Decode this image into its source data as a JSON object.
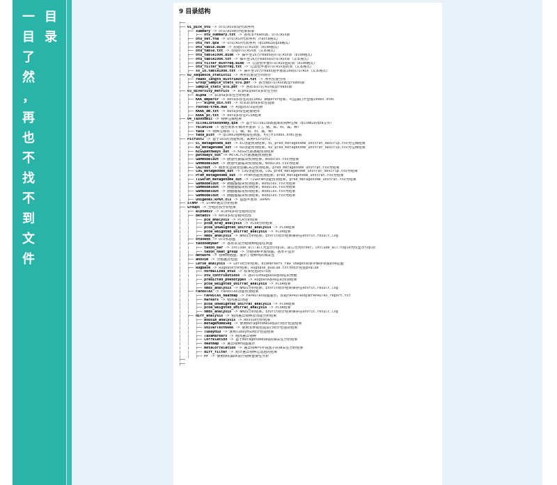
{
  "banner": {
    "left_column": [
      "一",
      "目",
      "了",
      "然",
      "，",
      "再",
      "也",
      "不",
      "找",
      "不",
      "到",
      "文",
      "件"
    ],
    "right_column": [
      "目",
      "录"
    ]
  },
  "document": {
    "heading": "9 目录结构",
    "tree": [
      {
        "d": 0,
        "name": "",
        "desc": ""
      },
      {
        "d": 1,
        "name": "01_pick_otu",
        "desc": "OTU/ASV表及代表序列"
      },
      {
        "d": 2,
        "name": "summary",
        "desc": "OTU/ASV统计结果目录"
      },
      {
        "d": 3,
        "name": "otu_summary.txt",
        "desc": "各样本reads数、OTU/ASV数"
      },
      {
        "d": 2,
        "name": "otu_set.fna",
        "desc": "OTU/ASV代表序列（fasta格式）"
      },
      {
        "d": 2,
        "name": "otu_ref.qza",
        "desc": "OTU/ASV代表序列（qiime2的qza格式）"
      },
      {
        "d": 2,
        "name": "otu_table.biom",
        "desc": "原始OTU/ASV表（biom格式）"
      },
      {
        "d": 2,
        "name": "otu_table.txt",
        "desc": "原始OTU/ASV表（文本格式）"
      },
      {
        "d": 2,
        "name": "otu_table100k.biom",
        "desc": "抽平至10万reads的OTU/ASV表（biom格式）"
      },
      {
        "d": 2,
        "name": "otu_table100k.txt",
        "desc": "抽平至10万reads的OTU/ASV表（文本格式）"
      },
      {
        "d": 2,
        "name": "otu_filter_minfreq.biom",
        "desc": "过滤低丰度OTU/ASV后的表（biom格式）"
      },
      {
        "d": 2,
        "name": "otu_filter_minfreq.txt",
        "desc": "过滤低丰度OTU/ASV后的表（文本格式）"
      },
      {
        "d": 2,
        "name": "ss_10.table100k.txt",
        "desc": "抽平至10万reads后丰度前10的OTU/ASV（文本格式）"
      },
      {
        "d": 1,
        "name": "02_sequence_statistic",
        "desc": "序列长度及分布统计"
      },
      {
        "d": 2,
        "name": "reads_length_distribution.txt",
        "desc": "序列长度分布"
      },
      {
        "d": 2,
        "name": "Group_Sample_stats_OTU.pdf",
        "desc": "各分组OTU/ASV数及reads数"
      },
      {
        "d": 2,
        "name": "Sample_stats_OTU.pdf",
        "desc": "各样本OTU/ASV数及reads数"
      },
      {
        "d": 1,
        "name": "03_diversity_metrics",
        "desc": "alpha及beta多样性分析"
      },
      {
        "d": 2,
        "name": "alpha",
        "desc": "alpha多样性分析结果"
      },
      {
        "d": 2,
        "name": "KKK_emperor",
        "desc": "beta多样性的qiime2 emperor结果，可直接打开查看index.html"
      },
      {
        "d": 3,
        "name": "alpha_div.txt",
        "desc": "样本alpha多样性指数"
      },
      {
        "d": 2,
        "name": "rooted-tree.nwk",
        "desc": "构建的OTU进化树"
      },
      {
        "d": 2,
        "name": "KKKK_dm.txt",
        "desc": "beta多样性距离矩阵"
      },
      {
        "d": 2,
        "name": "KKKK_pc.txt",
        "desc": "beta多样性PCoA结果"
      },
      {
        "d": 1,
        "name": "04_Taxonomic",
        "desc": "物种注释结果"
      },
      {
        "d": 2,
        "name": "silva138taxonomy.qza",
        "desc": "基于silva138数据库的物种注释（qiime2的qza文件）"
      },
      {
        "d": 2,
        "name": "relative",
        "desc": "各分类水平相对丰度表（门、纲、目、科、属、种）"
      },
      {
        "d": 2,
        "name": "taxa",
        "desc": "物种注释表（门、纲、目、科、属、种）"
      },
      {
        "d": 2,
        "name": "taxa_plot",
        "desc": "qiime2物种组成柱状图，可打开index.html查看"
      },
      {
        "d": 1,
        "name": "Picrust2",
        "desc": "基于16S的功能预测，采用Picrust2"
      },
      {
        "d": 2,
        "name": "EC_metagenome_out",
        "desc": "EC功能预测结果，EC_pred_metagenome_unstrat_descrip.tsv为注释结果"
      },
      {
        "d": 2,
        "name": "KO_metagenome_out",
        "desc": "KO功能预测结果，KO_pred_metagenome_unstrat_descrip.tsv为注释结果"
      },
      {
        "d": 2,
        "name": "KEGGpathways_out",
        "desc": "KEGG代谢通路预测结果"
      },
      {
        "d": 2,
        "name": "pathways_out",
        "desc": "METACYC代谢通路预测结果"
      },
      {
        "d": 2,
        "name": "GBMmodelout",
        "desc": "肠道代谢模块预测结果，modules.tsv为结果"
      },
      {
        "d": 2,
        "name": "GMMmodelout",
        "desc": "肠道代谢模块预测结果，modules.tsv为结果"
      },
      {
        "d": 2,
        "name": "CAZYout",
        "desc": "碳水化合物活性酶CAZy预测结果，pred_metagenome_unstrat.tsv为结果"
      },
      {
        "d": 2,
        "name": "COG_metagenome_out",
        "desc": "COG功能预测，COG_pred_metagenome_unstrat_descrip.tsv为结果"
      },
      {
        "d": 2,
        "name": "PFAM_metagenome_out",
        "desc": "PFAM功能预测结果，pred_metagenome_unstrat.tsv为结果"
      },
      {
        "d": 2,
        "name": "TIGRFAM_metagenome_out",
        "desc": "TIGRFAM功能预测结果，pred_metagenome_unstrat.tsv为结果"
      },
      {
        "d": 2,
        "name": "GBMmodelout",
        "desc": "肠脑轴模块预测结果，modules.tsv为结果"
      },
      {
        "d": 2,
        "name": "GBMmodelout",
        "desc": "肠脑轴模块预测结果，modules.tsv为结果"
      },
      {
        "d": 2,
        "name": "GBMmodelout",
        "desc": "肠脑轴模块预测结果，modules.tsv为结果"
      },
      {
        "d": 2,
        "name": "GBMmodelout",
        "desc": "肠脑轴模块预测结果，modules.tsv为结果"
      },
      {
        "d": 2,
        "name": "Unigenes.RPKM.xls",
        "desc": "基因丰度表（RPKM）"
      },
      {
        "d": 1,
        "name": "STAMP",
        "desc": "STAMP差异分析结果"
      },
      {
        "d": 1,
        "name": "Groups",
        "desc": "分组比较分析结果"
      },
      {
        "d": 2,
        "name": "alphadiv",
        "desc": "alpha多样性组间比较"
      },
      {
        "d": 2,
        "name": "betadiv",
        "desc": "beta多样性组间比较"
      },
      {
        "d": 3,
        "name": "pca_analysis",
        "desc": "PCA分析结果"
      },
      {
        "d": 3,
        "name": "pcoa_bray_analysis",
        "desc": "PCoA分析结果"
      },
      {
        "d": 3,
        "name": "pcoa_unweighted_unifrac_analysis",
        "desc": "PCoA结果"
      },
      {
        "d": 3,
        "name": "pcoa_weighted_unifrac_analysis",
        "desc": "PCoA结果"
      },
      {
        "d": 3,
        "name": "nmds_analysis",
        "desc": "NMDS分析结果，Envfit统计结果保存在envfit.result.log"
      },
      {
        "d": 2,
        "name": "otuVenn",
        "desc": "OTU韦恩图"
      },
      {
        "d": 2,
        "name": "taxonomyBar",
        "desc": "各样本及分组物种组成柱状图"
      },
      {
        "d": 3,
        "name": "taxon_bar",
        "desc": "include_all:all为显示top10，其它归为other；include_all:top10为仅显示top10"
      },
      {
        "d": 3,
        "name": "taxon_heat_group",
        "desc": "分组物种丰度热图，各水平显示"
      },
      {
        "d": 2,
        "name": "Network",
        "desc": "物种网络图，展示了物种间的相关性"
      },
      {
        "d": 2,
        "name": "anosim",
        "desc": "分组差异检验"
      },
      {
        "d": 2,
        "name": "Lefse_analysis",
        "desc": "Lefse分析结果，biomarkers_raw_images目录中保存单独的特征图"
      },
      {
        "d": 2,
        "name": "Rugbase",
        "desc": "Rugbase分析结果，Rugbase_pvalue.txt为统计检验pvalue"
      },
      {
        "d": 3,
        "name": "normalized_otus",
        "desc": "标准化后的OTU表"
      },
      {
        "d": 3,
        "name": "otu_contributions",
        "desc": "各OTU对Rugbase各特征的贡献"
      },
      {
        "d": 3,
        "name": "predicted_phenotypes",
        "desc": "Rugbase各特征的预测结果"
      },
      {
        "d": 3,
        "name": "pcoa_weighted_unifrac_analysis",
        "desc": "PCoA结果"
      },
      {
        "d": 3,
        "name": "nmds_analysis",
        "desc": "NMDS分析结果，Envfit统计结果保存在envfit.result.log"
      },
      {
        "d": 2,
        "name": "FAPROTAX",
        "desc": "FAPROTAX功能预测结果"
      },
      {
        "d": 3,
        "name": "FAPROTAX_heatmap",
        "desc": "FAPROTAX热图展示，原始FAPROTAX结果FAPROTAX_report.txt"
      },
      {
        "d": 3,
        "name": "Markers",
        "desc": "组间差异功能"
      },
      {
        "d": 3,
        "name": "pcoa_unweighted_unifrac_analysis",
        "desc": "PCoA结果"
      },
      {
        "d": 3,
        "name": "pcoa_weighted_unifrac_analysis",
        "desc": "PCoA结果"
      },
      {
        "d": 3,
        "name": "nmds_analysis",
        "desc": "NMDS分析结果，Envfit统计结果保存在envfit.result.log"
      },
      {
        "d": 2,
        "name": "diff_analysis",
        "desc": "组间差异物种及功能分析结果"
      },
      {
        "d": 3,
        "name": "Anosim_analysis",
        "desc": "Anosim分析结果"
      },
      {
        "d": 3,
        "name": "metagenomeSeq",
        "desc": "使用metagenomeSeq进行统计检验结果"
      },
      {
        "d": 3,
        "name": "UnivarTestKKKK",
        "desc": "使用非参数检验进行统计检验的结果"
      },
      {
        "d": 3,
        "name": "TukeyHSD",
        "desc": "使用TukeyHSD统计检验结果"
      },
      {
        "d": 3,
        "name": "TaxaMarkers",
        "desc": "组间差异物种"
      },
      {
        "d": 3,
        "name": "Correlation",
        "desc": "基于metagenomeSeq的相关性分析结果"
      },
      {
        "d": 3,
        "name": "heatmap",
        "desc": "差异物种热图展示"
      },
      {
        "d": 3,
        "name": "metaCorrelation",
        "desc": "差异物种与环境因子的相关性分析结果"
      },
      {
        "d": 3,
        "name": "diff_filter",
        "desc": "统计差异物种过滤后的结果"
      },
      {
        "d": 3,
        "name": "FF",
        "desc": "使用随机森林进行物种重要性分析"
      },
      {
        "d": 0,
        "name": "",
        "desc": ""
      },
      {
        "d": 0,
        "name": "",
        "desc": ""
      }
    ]
  }
}
